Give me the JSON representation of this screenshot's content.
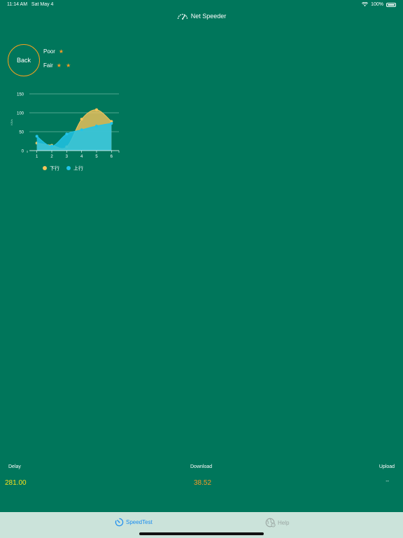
{
  "status_bar": {
    "time": "11:14 AM",
    "date": "Sat May 4",
    "battery": "100%"
  },
  "header": {
    "title": "Net Speeder",
    "icon": "speedometer-icon"
  },
  "back_button": {
    "label": "Back"
  },
  "ratings": [
    {
      "label": "Poor",
      "stars": "★"
    },
    {
      "label": "Fair",
      "stars": "★ ★"
    }
  ],
  "chart_data": {
    "type": "area",
    "x": [
      1,
      2,
      3,
      4,
      5,
      6
    ],
    "ylabel": "KB/s",
    "ylim": [
      0,
      150
    ],
    "yticks": [
      0,
      50,
      100,
      150
    ],
    "grid": true,
    "legend_position": "bottom-left",
    "series": [
      {
        "name": "下行",
        "color": "#f5c45a",
        "values": [
          20,
          14,
          10,
          83,
          108,
          77
        ]
      },
      {
        "name": "上行",
        "color": "#21c4e8",
        "values": [
          38,
          12,
          44,
          55,
          65,
          72
        ]
      }
    ]
  },
  "metrics": {
    "delay": {
      "label": "Delay",
      "value": "281.00",
      "color": "#f5e01e"
    },
    "download": {
      "label": "Download",
      "value": "38.52",
      "color": "#f29a26"
    },
    "upload": {
      "label": "Upload",
      "value": "--",
      "color": "#ffffff"
    }
  },
  "tabs": [
    {
      "label": "SpeedTest",
      "icon": "speedtest-icon",
      "color": "#1a8cf0",
      "active": true
    },
    {
      "label": "Help",
      "icon": "help-globe-icon",
      "color": "#9aa6a2",
      "active": false
    }
  ]
}
